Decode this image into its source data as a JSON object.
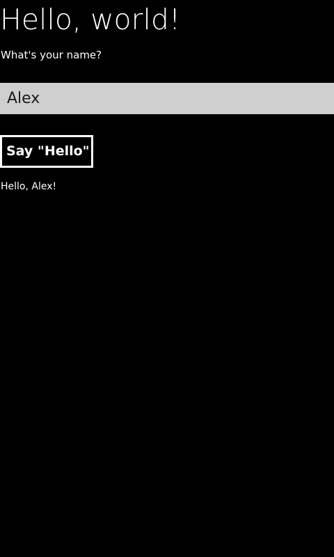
{
  "page": {
    "title": "Hello, world!",
    "prompt": "What's your name?"
  },
  "form": {
    "name_value": "Alex",
    "button_label": "Say \"Hello\""
  },
  "output": {
    "greeting": "Hello, Alex!"
  },
  "colors": {
    "background": "#000000",
    "text": "#ffffff",
    "input_background": "#cfcfcf",
    "input_text": "#1a1a1a",
    "button_border": "#ffffff"
  }
}
